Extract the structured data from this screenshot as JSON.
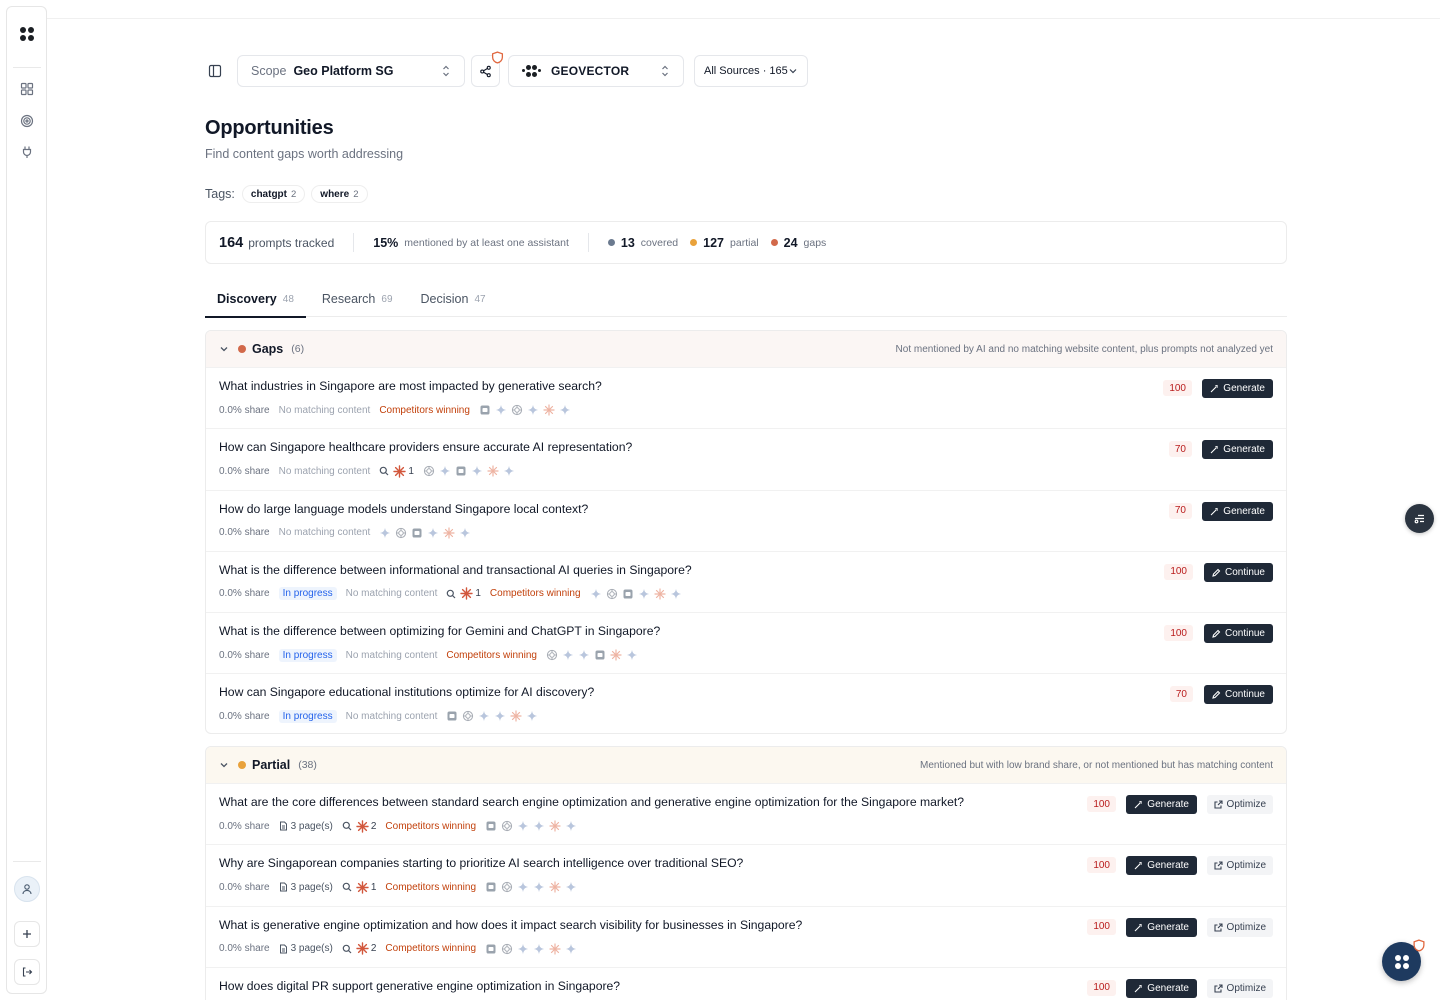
{
  "toolbar": {
    "scope_label": "Scope",
    "scope_value": "Geo Platform SG",
    "brand_name": "GEOVECTOR",
    "sources_label": "All Sources · 165"
  },
  "page": {
    "title": "Opportunities",
    "subtitle": "Find content gaps worth addressing"
  },
  "tags": {
    "label": "Tags:",
    "items": [
      {
        "name": "chatgpt",
        "count": "2"
      },
      {
        "name": "where",
        "count": "2"
      }
    ]
  },
  "stats": {
    "tracked_num": "164",
    "tracked_label": "prompts tracked",
    "mention_pct": "15%",
    "mention_label": "mentioned by at least one assistant",
    "covered_num": "13",
    "covered_label": "covered",
    "partial_num": "127",
    "partial_label": "partial",
    "gaps_num": "24",
    "gaps_label": "gaps",
    "colors": {
      "covered": "#6b7a8f",
      "partial": "#e9a23b",
      "gaps": "#d2694a"
    }
  },
  "tabs": [
    {
      "label": "Discovery",
      "count": "48"
    },
    {
      "label": "Research",
      "count": "69"
    },
    {
      "label": "Decision",
      "count": "47"
    }
  ],
  "gaps_group": {
    "name": "Gaps",
    "count": "(6)",
    "description": "Not mentioned by AI and no matching website content, plus prompts not analyzed yet",
    "rows": [
      {
        "question": "What industries in Singapore are most impacted by generative search?",
        "share": "0.0% share",
        "progress": "",
        "nomatch": "No matching content",
        "rank": "",
        "competitors": "Competitors winning",
        "score": "100",
        "action": "Generate"
      },
      {
        "question": "How can Singapore healthcare providers ensure accurate AI representation?",
        "share": "0.0% share",
        "progress": "",
        "nomatch": "No matching content",
        "rank": "1",
        "competitors": "",
        "score": "70",
        "action": "Generate"
      },
      {
        "question": "How do large language models understand Singapore local context?",
        "share": "0.0% share",
        "progress": "",
        "nomatch": "No matching content",
        "rank": "",
        "competitors": "",
        "score": "70",
        "action": "Generate"
      },
      {
        "question": "What is the difference between informational and transactional AI queries in Singapore?",
        "share": "0.0% share",
        "progress": "In progress",
        "nomatch": "No matching content",
        "rank": "1",
        "competitors": "Competitors winning",
        "score": "100",
        "action": "Continue"
      },
      {
        "question": "What is the difference between optimizing for Gemini and ChatGPT in Singapore?",
        "share": "0.0% share",
        "progress": "In progress",
        "nomatch": "No matching content",
        "rank": "",
        "competitors": "Competitors winning",
        "score": "100",
        "action": "Continue"
      },
      {
        "question": "How can Singapore educational institutions optimize for AI discovery?",
        "share": "0.0% share",
        "progress": "In progress",
        "nomatch": "No matching content",
        "rank": "",
        "competitors": "",
        "score": "70",
        "action": "Continue"
      }
    ]
  },
  "partial_group": {
    "name": "Partial",
    "count": "(38)",
    "description": "Mentioned but with low brand share, or not mentioned but has matching content",
    "rows": [
      {
        "question": "What are the core differences between standard search engine optimization and generative engine optimization for the Singapore market?",
        "share": "0.0% share",
        "pages": "3 page(s)",
        "rank": "2",
        "competitors": "Competitors winning",
        "score": "100",
        "action": "Generate",
        "secondary": "Optimize"
      },
      {
        "question": "Why are Singaporean companies starting to prioritize AI search intelligence over traditional SEO?",
        "share": "0.0% share",
        "pages": "3 page(s)",
        "rank": "1",
        "competitors": "Competitors winning",
        "score": "100",
        "action": "Generate",
        "secondary": "Optimize"
      },
      {
        "question": "What is generative engine optimization and how does it impact search visibility for businesses in Singapore?",
        "share": "0.0% share",
        "pages": "3 page(s)",
        "rank": "2",
        "competitors": "Competitors winning",
        "score": "100",
        "action": "Generate",
        "secondary": "Optimize"
      },
      {
        "question": "How does digital PR support generative engine optimization in Singapore?",
        "share": "",
        "pages": "",
        "rank": "",
        "competitors": "",
        "score": "100",
        "action": "Generate",
        "secondary": "Optimize"
      }
    ]
  }
}
